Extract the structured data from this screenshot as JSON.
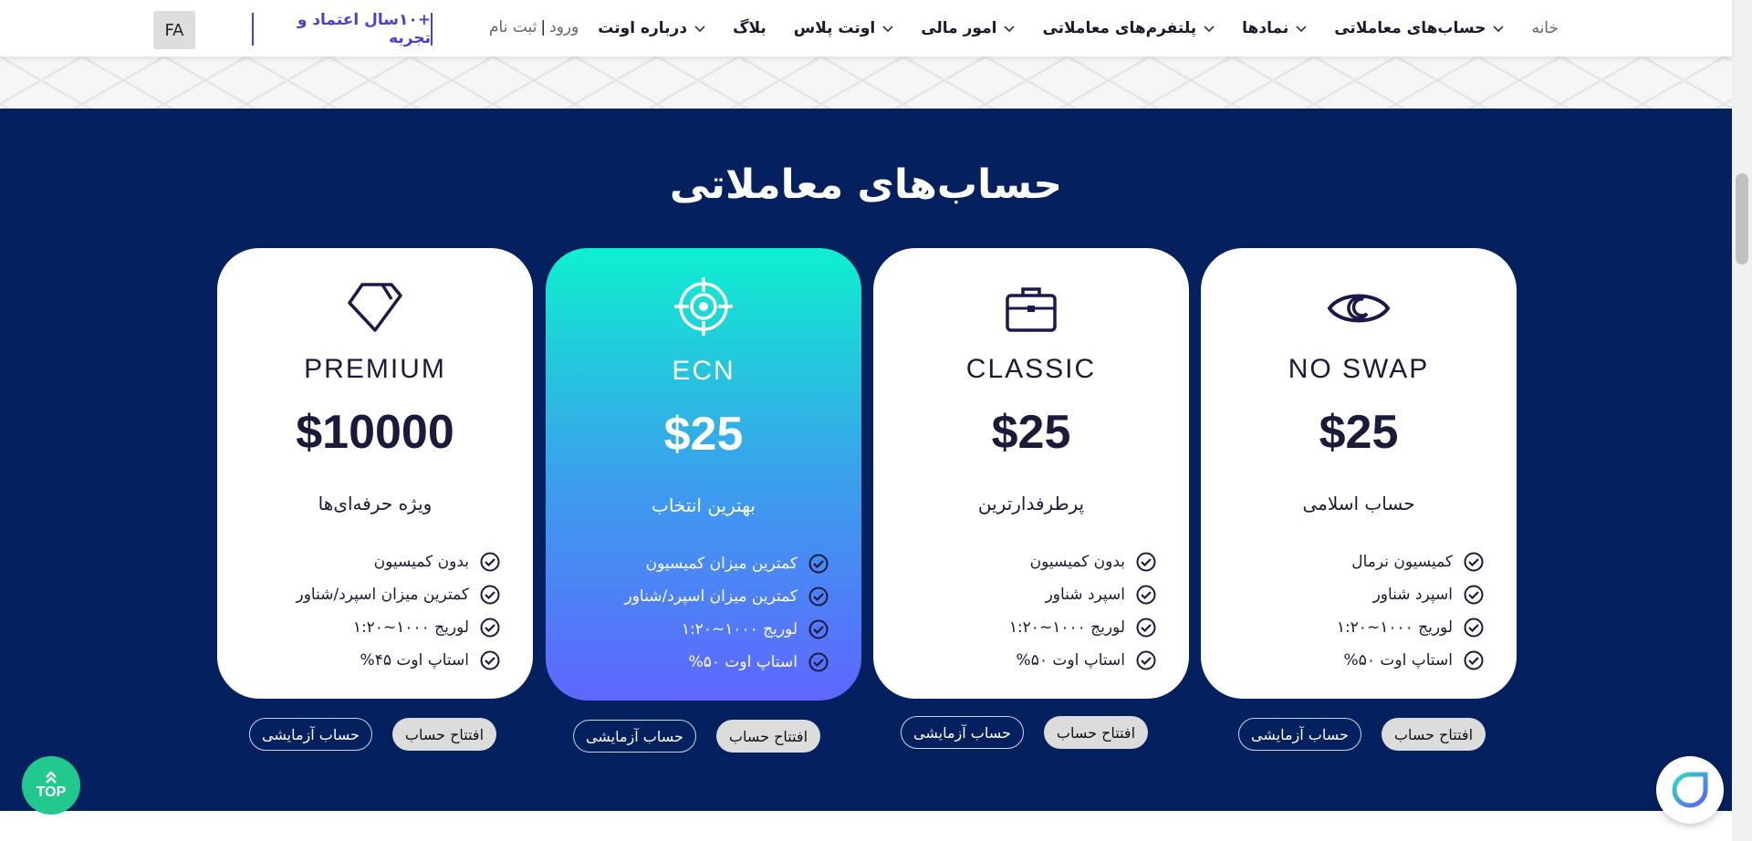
{
  "header": {
    "lang": "FA",
    "tagline": "+۱۰سال اعتماد و تجربه",
    "login": "ورود",
    "separator": "|",
    "register": "ثبت نام",
    "nav": [
      {
        "label": "خانه",
        "dropdown": false
      },
      {
        "label": "حساب‌های معاملاتی",
        "dropdown": true
      },
      {
        "label": "نمادها",
        "dropdown": true
      },
      {
        "label": "پلتفرم‌های معاملاتی",
        "dropdown": true
      },
      {
        "label": "امور مالی",
        "dropdown": true
      },
      {
        "label": "اوتت پلاس",
        "dropdown": true
      },
      {
        "label": "بلاگ",
        "dropdown": false
      },
      {
        "label": "درباره اوتت",
        "dropdown": true
      }
    ]
  },
  "section": {
    "title": "حساب‌های معاملاتی",
    "open_label": "افتتاح حساب",
    "demo_label": "حساب آزمایشی"
  },
  "cards": [
    {
      "name": "NO SWAP",
      "price": "$25",
      "subtitle": "حساب اسلامی",
      "icon": "eye-icon",
      "features": [
        "کمیسیون نرمال",
        "اسپرد شناور",
        "لوریج ۱۰۰۰~۱:۲۰",
        "استاپ اوت ۵۰%"
      ]
    },
    {
      "name": "CLASSIC",
      "price": "$25",
      "subtitle": "پرطرفدارترین",
      "icon": "briefcase-icon",
      "features": [
        "بدون کمیسیون",
        "اسپرد شناور",
        "لوریج ۱۰۰۰~۱:۲۰",
        "استاپ اوت ۵۰%"
      ]
    },
    {
      "name": "ECN",
      "price": "$25",
      "subtitle": "بهترین انتخاب",
      "icon": "target-icon",
      "features": [
        "کمترین میزان کمیسیون",
        "کمترین میزان اسپرد/شناور",
        "لوریج ۱۰۰۰~۱:۲۰",
        "استاپ اوت ۵۰%"
      ]
    },
    {
      "name": "PREMIUM",
      "price": "$10000",
      "subtitle": "ویژه حرفه‌ای‌ها",
      "icon": "diamond-tag-icon",
      "features": [
        "بدون کمیسیون",
        "کمترین میزان اسپرد/شناور",
        "لوریج ۱۰۰۰~۱:۲۰",
        "استاپ اوت ۴۵%"
      ]
    }
  ],
  "floating": {
    "top_label": "TOP"
  },
  "colors": {
    "navy": "#04205f",
    "accent": "#4b3fd3",
    "green": "#21c98f",
    "text_dark": "#1a1a3a"
  }
}
